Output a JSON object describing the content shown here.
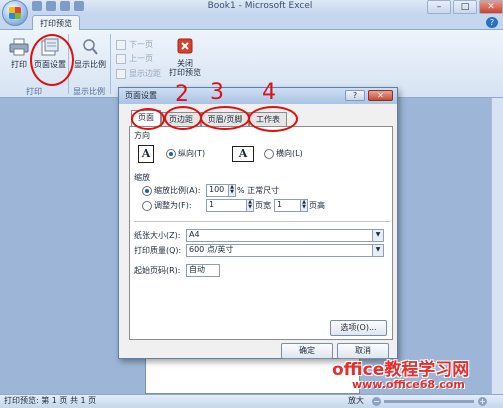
{
  "window": {
    "title": "Book1 - Microsoft Excel",
    "minimize": "–",
    "maximize": "□",
    "close": "✕"
  },
  "ribbon": {
    "tab": "打印预览",
    "help": "?",
    "buttons": {
      "print": "打印",
      "page_setup": "页面设置",
      "zoom": "显示比例",
      "next_page": "下一页",
      "prev_page": "上一页",
      "show_margins": "显示边距",
      "close_preview": "关闭\n打印预览"
    },
    "groups": {
      "print": "打印",
      "zoom": "显示比例"
    }
  },
  "dialog": {
    "title": "页面设置",
    "help": "?",
    "close": "✕",
    "tabs": [
      "页面",
      "页边距",
      "页眉/页脚",
      "工作表"
    ],
    "active_tab": 0,
    "orientation": {
      "label": "方向",
      "portrait": "纵向(T)",
      "landscape": "横向(L)",
      "selected": "portrait"
    },
    "scaling": {
      "label": "缩放",
      "adjust_to": "缩放比例(A):",
      "adjust_value": "100",
      "adjust_suffix": "% 正常尺寸",
      "fit_to": "调整为(F):",
      "fit_wide": "1",
      "fit_wide_suffix": "页宽",
      "fit_tall": "1",
      "fit_tall_suffix": "页高",
      "selected": "adjust"
    },
    "paper_size": {
      "label": "纸张大小(Z):",
      "value": "A4"
    },
    "print_quality": {
      "label": "打印质量(Q):",
      "value": "600 点/英寸"
    },
    "first_page_number": {
      "label": "起始页码(R):",
      "value": "自动"
    },
    "options_button": "选项(O)...",
    "ok_button": "确定",
    "cancel_button": "取消"
  },
  "annotations": [
    "2",
    "3",
    "4"
  ],
  "status": {
    "text": "打印预览: 第 1 页 共 1 页",
    "zoom_label": "放大",
    "zoom_minus": "−",
    "zoom_plus": "+"
  },
  "watermark": {
    "main": "office教程学习网",
    "url": "www.office68.com"
  }
}
